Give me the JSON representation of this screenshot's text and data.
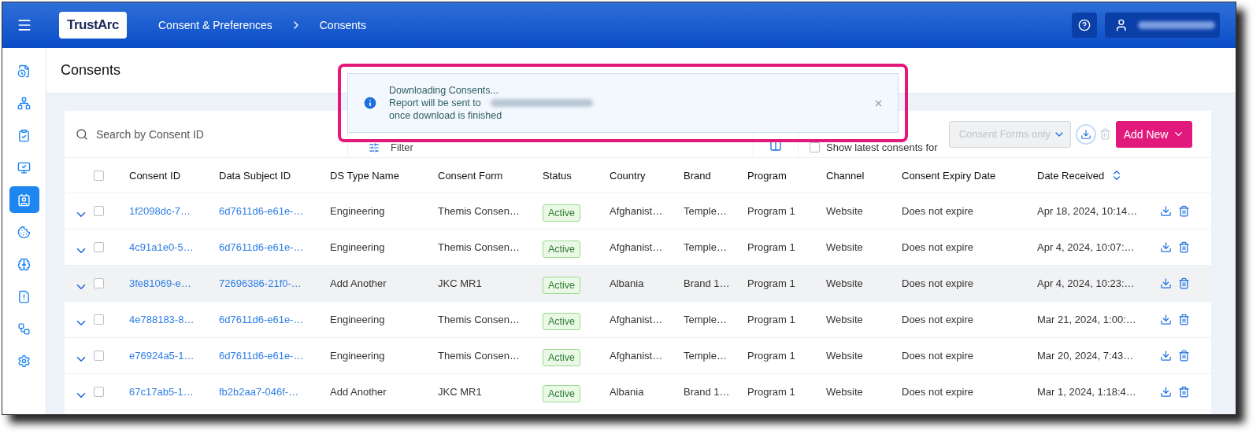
{
  "header": {
    "logo": "TrustArc",
    "breadcrumb": [
      "Consent & Preferences",
      "Consents"
    ]
  },
  "sidebar": {
    "items": [
      {
        "selected": false
      },
      {
        "selected": false
      },
      {
        "selected": false
      },
      {
        "selected": false
      },
      {
        "selected": true
      },
      {
        "selected": false
      },
      {
        "selected": false
      },
      {
        "selected": false
      },
      {
        "selected": false
      },
      {
        "selected": false
      }
    ]
  },
  "page": {
    "title": "Consents"
  },
  "toast": {
    "lines": [
      "Downloading Consents...",
      "Report will be sent to",
      "once download is finished"
    ]
  },
  "toolbar": {
    "search": {
      "placeholder": "Search by Consent ID"
    },
    "filter": "Filter",
    "latest": {
      "label": "Show latest consents for",
      "checked": false
    },
    "select": {
      "value": "Consent Forms only",
      "disabled": true
    },
    "add_button": "Add New"
  },
  "table": {
    "select_all": {
      "checked": false
    },
    "columns": [
      "Consent ID",
      "Data Subject ID",
      "DS Type Name",
      "Consent Form",
      "Status",
      "Country",
      "Brand",
      "Program",
      "Channel",
      "Consent Expiry Date",
      "Date Received"
    ],
    "rows": [
      {
        "hovered": false,
        "checked": false,
        "cells": [
          "1f2098dc-7…",
          "6d7611d6-e61e-…",
          "Engineering",
          "Themis Consen…",
          "Active",
          "Afghanist…",
          "Temple…",
          "Program 1",
          "Website",
          "Does not expire",
          "Apr 18, 2024, 10:14…"
        ]
      },
      {
        "hovered": false,
        "checked": false,
        "cells": [
          "4c91a1e0-5…",
          "6d7611d6-e61e-…",
          "Engineering",
          "Themis Consen…",
          "Active",
          "Afghanist…",
          "Temple…",
          "Program 1",
          "Website",
          "Does not expire",
          "Apr 4, 2024, 10:07:…"
        ]
      },
      {
        "hovered": true,
        "checked": false,
        "cells": [
          "3fe81069-e…",
          "72696386-21f0-…",
          "Add Another",
          "JKC MR1",
          "Active",
          "Albania",
          "Brand 1…",
          "Program 1",
          "Website",
          "Does not expire",
          "Apr 4, 2024, 10:23:…"
        ]
      },
      {
        "hovered": false,
        "checked": false,
        "cells": [
          "4e788183-8…",
          "6d7611d6-e61e-…",
          "Engineering",
          "Themis Consen…",
          "Active",
          "Afghanist…",
          "Temple…",
          "Program 1",
          "Website",
          "Does not expire",
          "Mar 21, 2024, 1:00:…"
        ]
      },
      {
        "hovered": false,
        "checked": false,
        "cells": [
          "e76924a5-1…",
          "6d7611d6-e61e-…",
          "Engineering",
          "Themis Consen…",
          "Active",
          "Afghanist…",
          "Temple…",
          "Program 1",
          "Website",
          "Does not expire",
          "Mar 20, 2024, 7:43…"
        ]
      },
      {
        "hovered": false,
        "checked": false,
        "cells": [
          "67c17ab5-1…",
          "fb2b2aa7-046f-…",
          "Add Another",
          "JKC MR1",
          "Active",
          "Albania",
          "Brand 1…",
          "Program 1",
          "Website",
          "Does not expire",
          "Mar 1, 2024, 1:18:4…"
        ]
      }
    ]
  }
}
